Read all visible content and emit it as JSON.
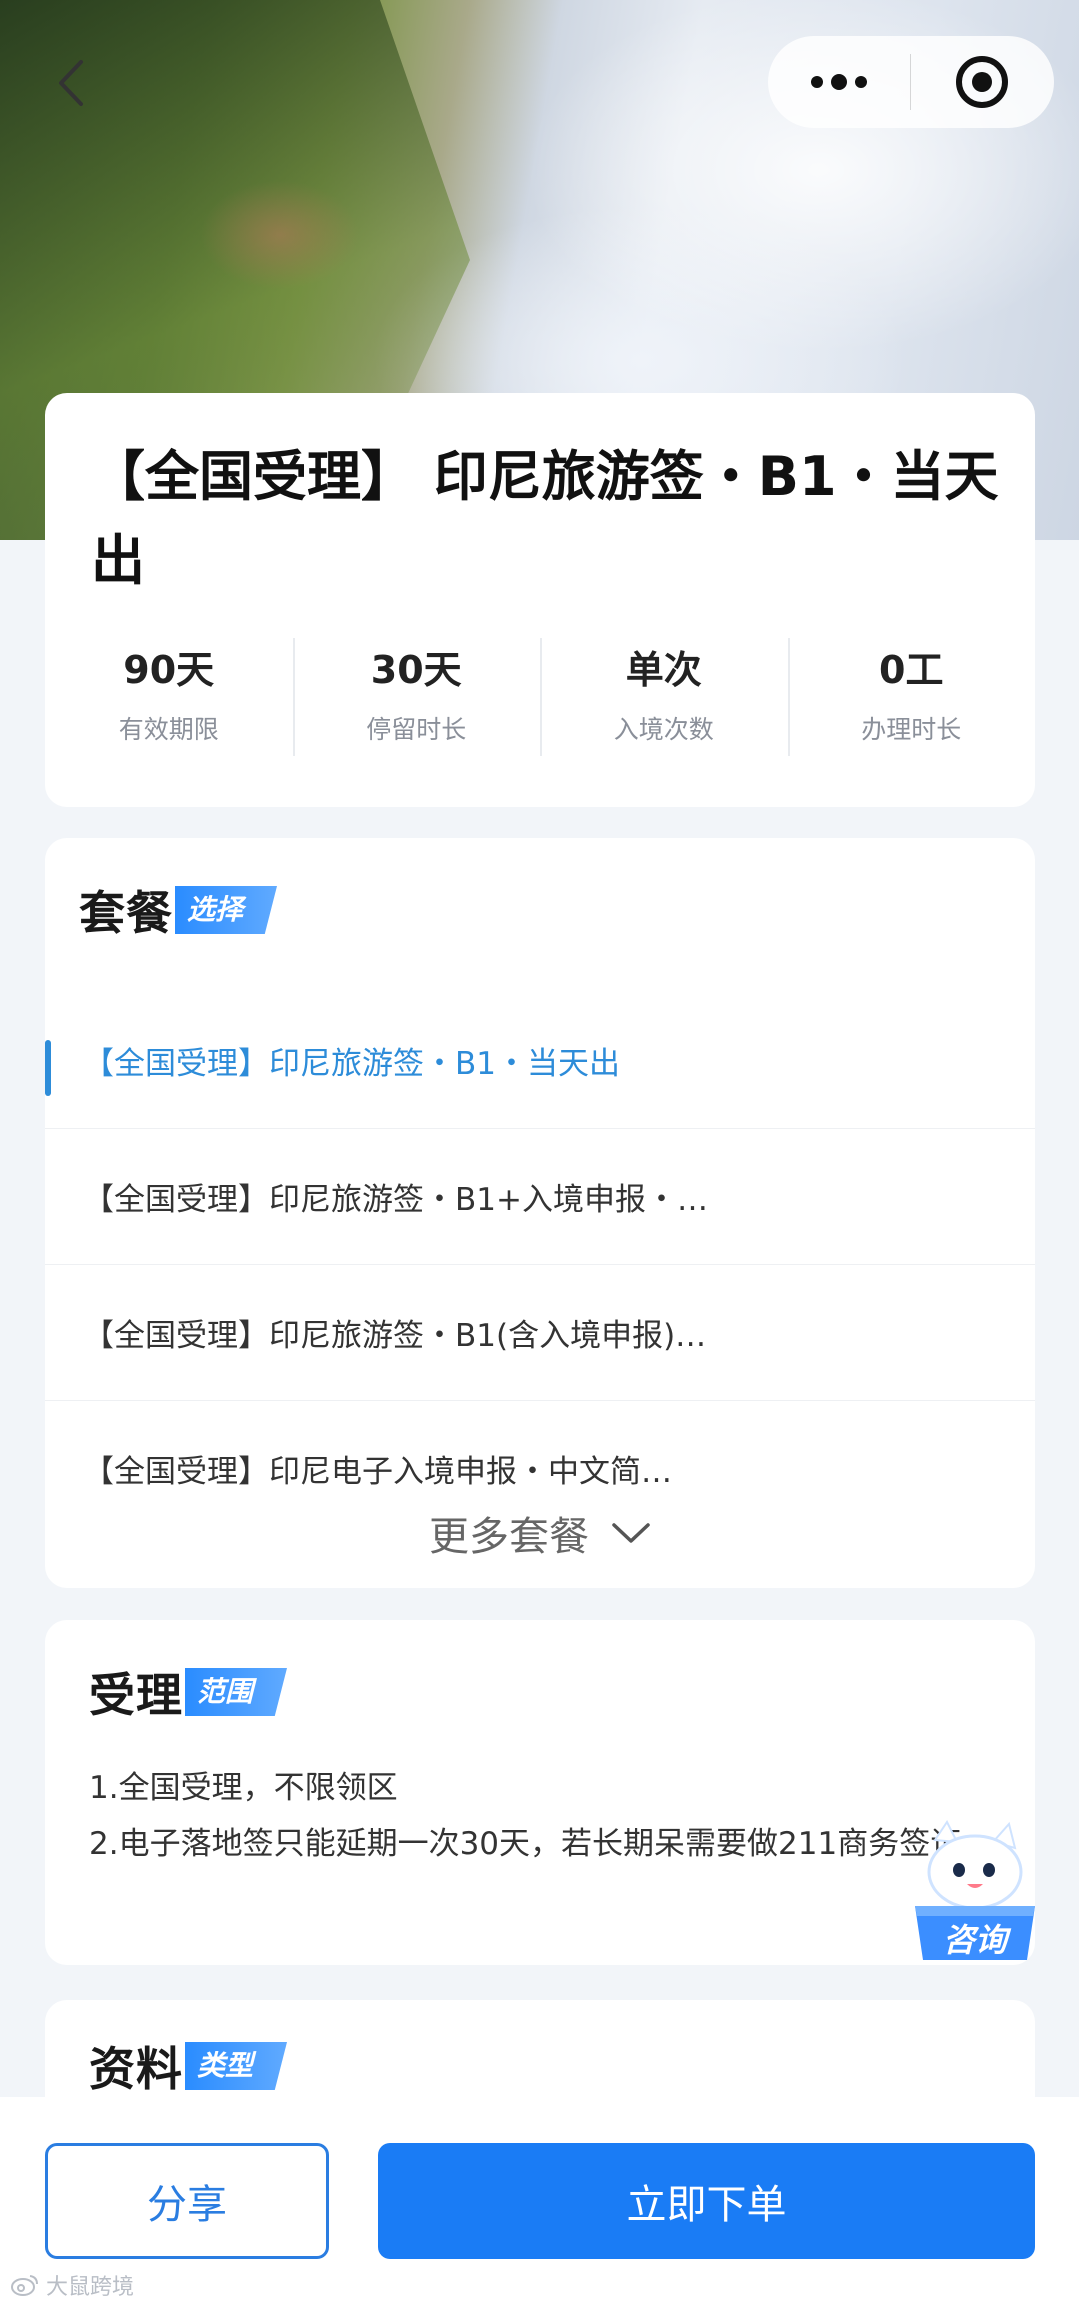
{
  "header": {
    "back_icon": "chevron-left-icon",
    "more_icon": "more-dots-icon",
    "target_icon": "target-icon"
  },
  "product": {
    "title": "【全国受理】 印尼旅游签・B1・当天出",
    "stats": [
      {
        "value": "90天",
        "label": "有效期限"
      },
      {
        "value": "30天",
        "label": "停留时长"
      },
      {
        "value": "单次",
        "label": "入境次数"
      },
      {
        "value": "0工",
        "label": "办理时长"
      }
    ]
  },
  "packages": {
    "heading_main": "套餐",
    "heading_tag": "选择",
    "items": [
      "【全国受理】印尼旅游签・B1・当天出",
      "【全国受理】印尼旅游签・B1+入境申报・…",
      "【全国受理】印尼旅游签・B1(含入境申报)…",
      "【全国受理】印尼电子入境申报・中文简…"
    ],
    "more_label": "更多套餐"
  },
  "scope": {
    "heading_main": "受理",
    "heading_tag": "范围",
    "line1": "1.全国受理，不限领区",
    "line2": "2.电子落地签只能延期一次30天，若长期呆需要做211商务签证"
  },
  "materials": {
    "heading_main": "资料",
    "heading_tag": "类型"
  },
  "consult": {
    "label": "咨询"
  },
  "actions": {
    "share_label": "分享",
    "order_label": "立即下单"
  },
  "watermark": {
    "text": "大鼠跨境"
  },
  "colors": {
    "accent": "#1a7cf5",
    "active_package": "#2d8cd9"
  }
}
